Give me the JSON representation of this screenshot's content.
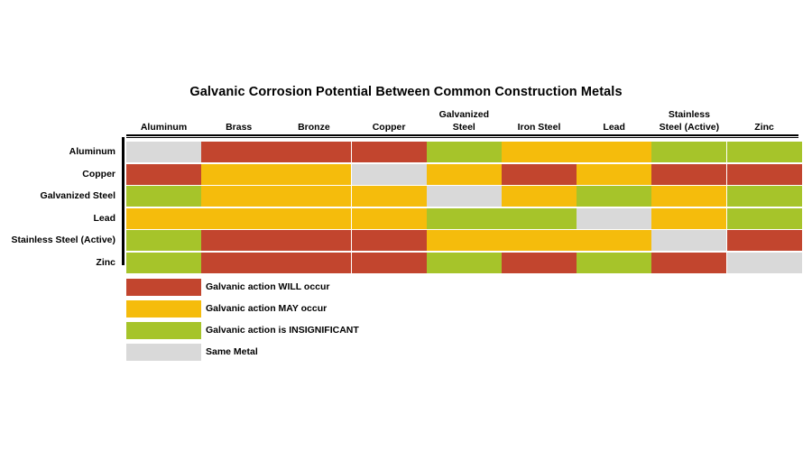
{
  "chart_data": {
    "type": "heatmap",
    "title": "Galvanic Corrosion Potential Between Common Construction Metals",
    "xlabel": "",
    "ylabel": "",
    "grid": false,
    "legend_position": "below-left",
    "categories_x": [
      "Aluminum",
      "Brass",
      "Bronze",
      "Copper",
      "Galvanized Steel",
      "Iron Steel",
      "Lead",
      "Stainless Steel (Active)",
      "Zinc"
    ],
    "categories_x_lines": [
      [
        "Aluminum"
      ],
      [
        "Brass"
      ],
      [
        "Bronze"
      ],
      [
        "Copper"
      ],
      [
        "Galvanized",
        "Steel"
      ],
      [
        "Iron Steel"
      ],
      [
        "Lead"
      ],
      [
        "Stainless",
        "Steel (Active)"
      ],
      [
        "Zinc"
      ]
    ],
    "categories_y": [
      "Aluminum",
      "Copper",
      "Galvanized Steel",
      "Lead",
      "Stainless Steel (Active)",
      "Zinc"
    ],
    "value_levels": {
      "will": "Galvanic action WILL occur",
      "may": "Galvanic action MAY occur",
      "insignificant": "Galvanic action is INSIGNIFICANT",
      "same": "Same Metal"
    },
    "level_colors": {
      "will": "#C2452E",
      "may": "#F5BC0C",
      "insignificant": "#A6C42A",
      "same": "#D9D9D9"
    },
    "rows": [
      {
        "label": "Aluminum",
        "values": [
          "same",
          "will",
          "will",
          "will",
          "insignificant",
          "may",
          "may",
          "insignificant",
          "insignificant"
        ]
      },
      {
        "label": "Copper",
        "values": [
          "will",
          "may",
          "may",
          "same",
          "may",
          "will",
          "may",
          "will",
          "will"
        ]
      },
      {
        "label": "Galvanized Steel",
        "values": [
          "insignificant",
          "may",
          "may",
          "may",
          "same",
          "may",
          "insignificant",
          "may",
          "insignificant"
        ]
      },
      {
        "label": "Lead",
        "values": [
          "may",
          "may",
          "may",
          "may",
          "insignificant",
          "insignificant",
          "same",
          "may",
          "insignificant"
        ]
      },
      {
        "label": "Stainless Steel (Active)",
        "values": [
          "insignificant",
          "will",
          "will",
          "will",
          "may",
          "may",
          "may",
          "same",
          "will"
        ]
      },
      {
        "label": "Zinc",
        "values": [
          "insignificant",
          "will",
          "will",
          "will",
          "insignificant",
          "will",
          "insignificant",
          "will",
          "same"
        ]
      }
    ],
    "legend": [
      {
        "key": "will",
        "label": "Galvanic action WILL occur",
        "color": "#C2452E"
      },
      {
        "key": "may",
        "label": "Galvanic action MAY occur",
        "color": "#F5BC0C"
      },
      {
        "key": "insignificant",
        "label": "Galvanic action is INSIGNIFICANT",
        "color": "#A6C42A"
      },
      {
        "key": "same",
        "label": "Same Metal",
        "color": "#D9D9D9"
      }
    ]
  }
}
